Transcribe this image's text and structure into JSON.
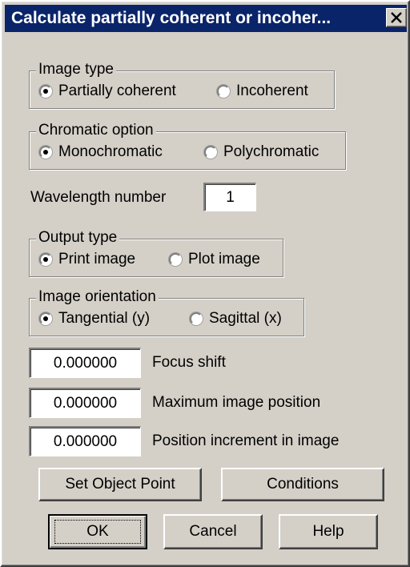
{
  "window": {
    "title": "Calculate partially coherent or incoher...",
    "close_icon": "close-x-icon",
    "title_bar_color": "#0a246a",
    "face_color": "#d4d0c8"
  },
  "image_type": {
    "legend": "Image type",
    "options": [
      "Partially coherent",
      "Incoherent"
    ],
    "selected": "Partially coherent"
  },
  "chromatic_option": {
    "legend": "Chromatic option",
    "options": [
      "Monochromatic",
      "Polychromatic"
    ],
    "selected": "Monochromatic"
  },
  "wavelength": {
    "label": "Wavelength number",
    "value": "1"
  },
  "output_type": {
    "legend": "Output type",
    "options": [
      "Print image",
      "Plot image"
    ],
    "selected": "Print image"
  },
  "image_orientation": {
    "legend": "Image orientation",
    "options": [
      "Tangential (y)",
      "Sagittal (x)"
    ],
    "selected": "Tangential (y)"
  },
  "fields": [
    {
      "value": "0.000000",
      "label": "Focus shift"
    },
    {
      "value": "0.000000",
      "label": "Maximum image position"
    },
    {
      "value": "0.000000",
      "label": "Position increment in image"
    }
  ],
  "buttons": {
    "set_object_point": "Set Object Point",
    "conditions": "Conditions",
    "ok": "OK",
    "cancel": "Cancel",
    "help": "Help"
  }
}
